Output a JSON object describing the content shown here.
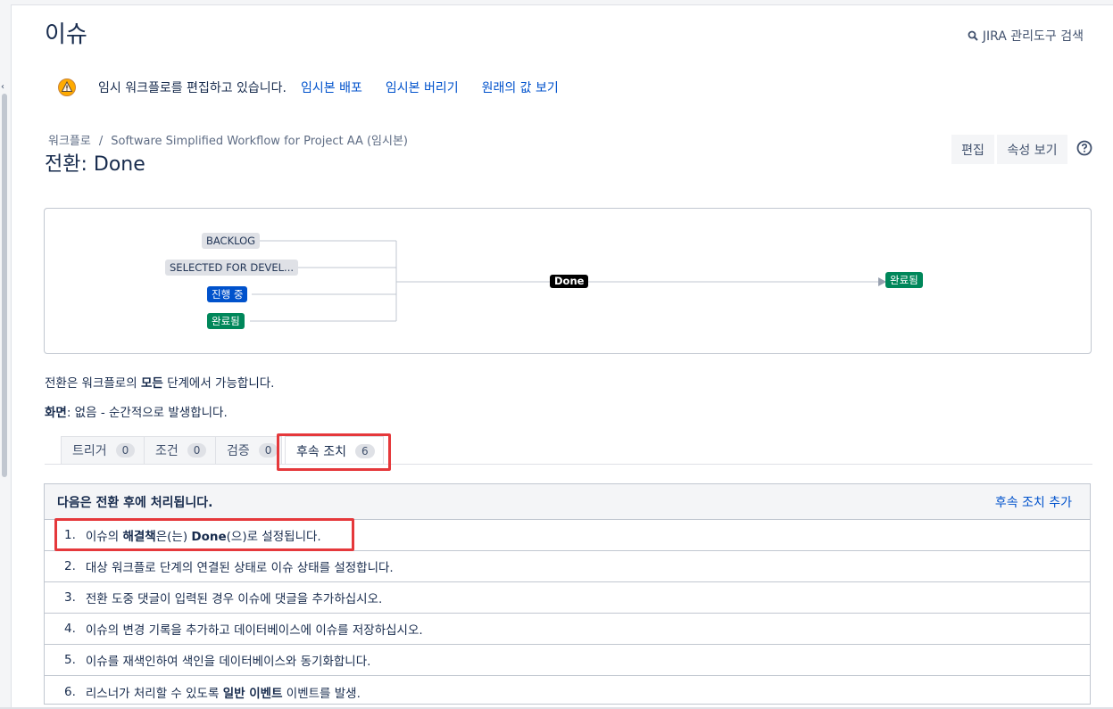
{
  "header": {
    "title": "이슈",
    "admin_search": "JIRA 관리도구 검색"
  },
  "warning": {
    "message": "임시 워크플로를 편집하고 있습니다.",
    "publish": "임시본 배포",
    "discard": "임시본 버리기",
    "view_original": "원래의 값 보기"
  },
  "breadcrumb": {
    "root": "워크플로",
    "separator": "/",
    "workflow": "Software Simplified Workflow for Project AA (임시본)"
  },
  "transition": {
    "prefix": "전환: ",
    "name": "Done"
  },
  "actions": {
    "edit": "편집",
    "view_properties": "속성 보기"
  },
  "diagram": {
    "sources": [
      {
        "label": "BACKLOG",
        "style": "gray"
      },
      {
        "label": "SELECTED FOR DEVEL...",
        "style": "gray"
      },
      {
        "label": "진행 중",
        "style": "blue"
      },
      {
        "label": "완료됨",
        "style": "green"
      }
    ],
    "transition_label": "Done",
    "target": {
      "label": "완료됨",
      "style": "green"
    }
  },
  "info": {
    "line1_pre": "전환은 워크플로의 ",
    "line1_bold": "모든",
    "line1_post": " 단계에서 가능합니다.",
    "line2_bold": "화면",
    "line2_post": ": 없음 - 순간적으로 발생합니다."
  },
  "tabs": [
    {
      "label": "트리거",
      "count": "0",
      "active": false
    },
    {
      "label": "조건",
      "count": "0",
      "active": false
    },
    {
      "label": "검증",
      "count": "0",
      "active": false
    },
    {
      "label": "후속 조치",
      "count": "6",
      "active": true
    }
  ],
  "post_functions": {
    "header": "다음은 전환 후에 처리됩니다.",
    "add_link": "후속 조치 추가",
    "items": [
      {
        "num": "1.",
        "parts": [
          {
            "t": "이슈의 "
          },
          {
            "t": "해결책",
            "b": true
          },
          {
            "t": "은(는) "
          },
          {
            "t": "Done",
            "b": true
          },
          {
            "t": "(으)로 설정됩니다."
          }
        ]
      },
      {
        "num": "2.",
        "parts": [
          {
            "t": "대상 워크플로 단계의 연결된 상태로 이슈 상태를 설정합니다."
          }
        ]
      },
      {
        "num": "3.",
        "parts": [
          {
            "t": "전환 도중 댓글이 입력된 경우 이슈에 댓글을 추가하십시오."
          }
        ]
      },
      {
        "num": "4.",
        "parts": [
          {
            "t": "이슈의 변경 기록을 추가하고 데이터베이스에 이슈를 저장하십시오."
          }
        ]
      },
      {
        "num": "5.",
        "parts": [
          {
            "t": "이슈를 재색인하여 색인을 데이터베이스와 동기화합니다."
          }
        ]
      },
      {
        "num": "6.",
        "parts": [
          {
            "t": "리스너가 처리할 수 있도록 "
          },
          {
            "t": "일반 이벤트",
            "b": true
          },
          {
            "t": " 이벤트를 발생."
          }
        ]
      }
    ]
  },
  "colors": {
    "link": "#0052cc",
    "highlight": "#e5383b",
    "status_blue": "#0052cc",
    "status_green": "#00875a",
    "status_gray": "#dfe1e6"
  },
  "icons": {
    "search": "magnifier-icon",
    "warning": "warning-triangle-icon",
    "help": "question-circle-icon"
  }
}
